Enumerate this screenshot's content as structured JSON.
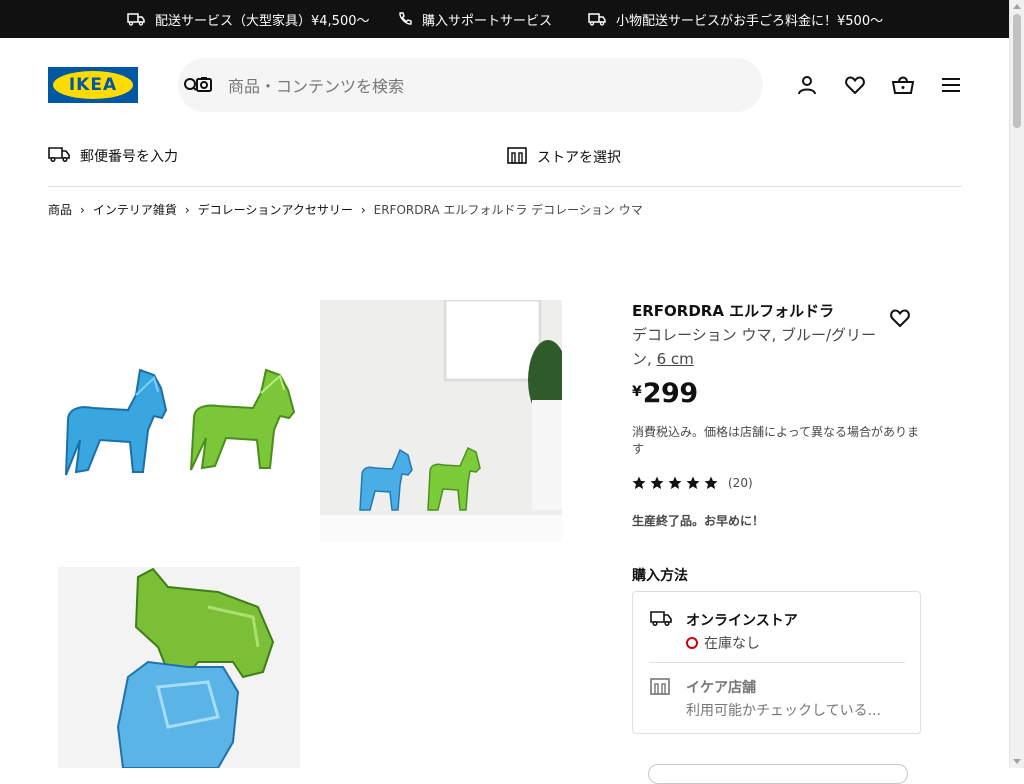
{
  "topbar": {
    "items": [
      {
        "icon": "truck-icon",
        "label": "配送サービス（大型家具）¥4,500〜"
      },
      {
        "icon": "phone-icon",
        "label": "購入サポートサービス"
      },
      {
        "icon": "truck-icon",
        "label": "小物配送サービスがお手ごろ料金に！¥500〜"
      }
    ]
  },
  "header": {
    "logo_text": "IKEA",
    "search_placeholder": "商品・コンテンツを検索"
  },
  "delivery": {
    "postal_label": "郵便番号を入力",
    "store_label": "ストアを選択"
  },
  "breadcrumb": {
    "items": [
      "商品",
      "インテリア雑貨",
      "デコレーションアクセサリー"
    ],
    "current": "ERFORDRA エルフォルドラ デコレーション ウマ"
  },
  "product": {
    "name": "ERFORDRA エルフォルドラ",
    "description": "デコレーション ウマ, ブルー/グリーン,",
    "size": "6 cm",
    "currency": "¥",
    "price": "299",
    "tax_note": "消費税込み。価格は店舗によって異なる場合があります",
    "rating_count": "(20)",
    "rating_stars": 5,
    "discontinued": "生産終了品。お早めに！"
  },
  "availability": {
    "heading": "購入方法",
    "online_title": "オンラインストア",
    "online_status": "在庫なし",
    "store_title": "イケア店舗",
    "store_status": "利用可能かチェックしている..."
  },
  "colors": {
    "ikea_blue": "#0058a3",
    "ikea_yellow": "#ffdb00",
    "out_of_stock": "#cc0008"
  }
}
